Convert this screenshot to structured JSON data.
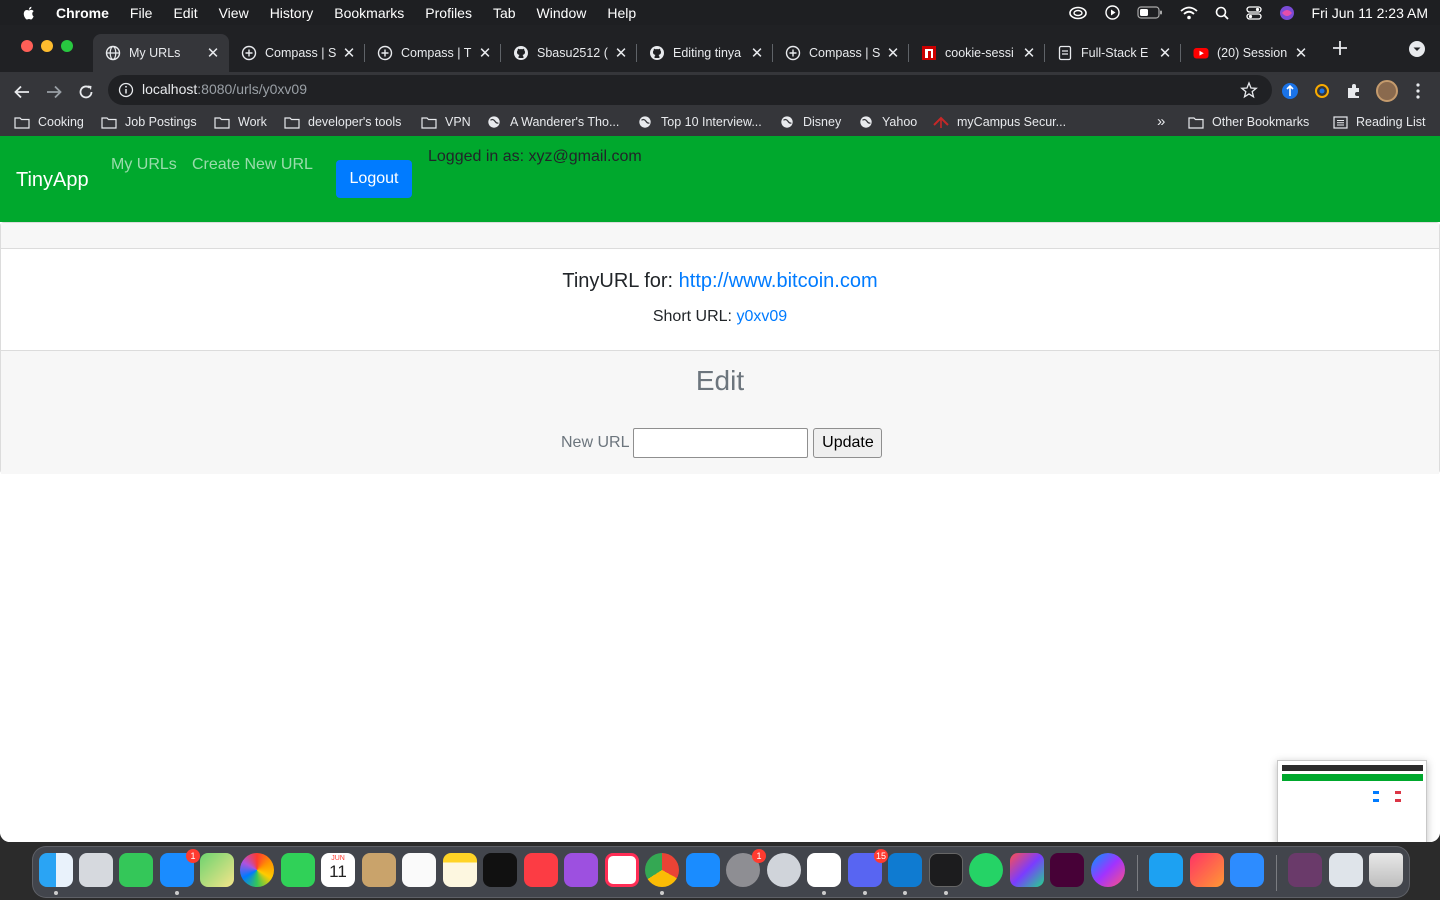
{
  "menubar": {
    "items": [
      "Chrome",
      "File",
      "Edit",
      "View",
      "History",
      "Bookmarks",
      "Profiles",
      "Tab",
      "Window",
      "Help"
    ],
    "clock": "Fri Jun 11  2:23 AM"
  },
  "tabs": [
    {
      "title": "My URLs",
      "icon": "globe-icon"
    },
    {
      "title": "Compass | S",
      "icon": "compass-icon"
    },
    {
      "title": "Compass | T",
      "icon": "compass-icon"
    },
    {
      "title": "Sbasu2512 (",
      "icon": "github-icon"
    },
    {
      "title": "Editing tinya",
      "icon": "github-icon"
    },
    {
      "title": "Compass | S",
      "icon": "compass-icon"
    },
    {
      "title": "cookie-sessi",
      "icon": "npm-icon"
    },
    {
      "title": "Full-Stack E",
      "icon": "doc-icon"
    },
    {
      "title": "(20) Session",
      "icon": "youtube-icon"
    }
  ],
  "address": {
    "host": "localhost",
    "path": ":8080/urls/y0xv09"
  },
  "bookmarks": {
    "items": [
      "Cooking",
      "Job Postings",
      "Work",
      "developer's tools",
      "VPN",
      "A Wanderer's Tho...",
      "Top 10 Interview...",
      "Disney",
      "Yahoo",
      "myCampus Secur..."
    ],
    "overflow": "»",
    "other": "Other Bookmarks",
    "reading_list": "Reading List"
  },
  "navbar": {
    "brand": "TinyApp",
    "my_urls": "My URLs",
    "create_new": "Create New URL",
    "logout": "Logout",
    "logged_in": "Logged in as: xyz@gmail.com"
  },
  "url_card": {
    "tiny_prefix": "TinyURL for: ",
    "long_url": "http://www.bitcoin.com",
    "short_prefix": "Short URL: ",
    "short_id": "y0xv09"
  },
  "edit": {
    "title": "Edit",
    "label": "New URL",
    "input_value": "",
    "button": "Update"
  },
  "dock": {
    "mail_badge": "1",
    "settings_badge": "1",
    "discord_badge": "15",
    "calendar_month": "JUN",
    "calendar_day": "11"
  },
  "colors": {
    "navbar_green": "#00a82d",
    "link_blue": "#007bff"
  }
}
